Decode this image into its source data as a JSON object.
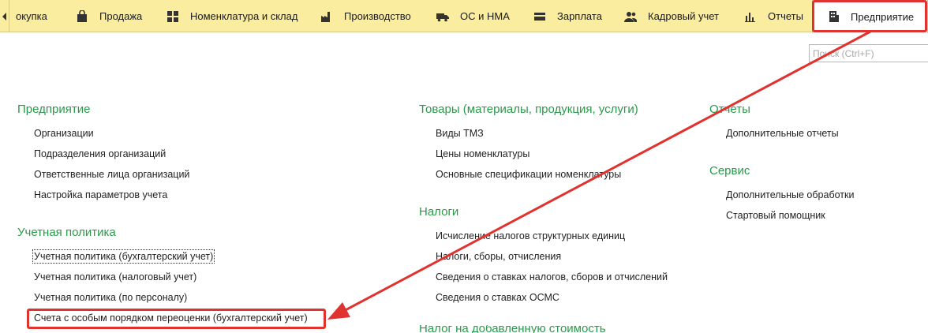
{
  "sections_bar": {
    "tabs": [
      {
        "label": "окупка",
        "icon": "purchase-icon"
      },
      {
        "label": "Продажа",
        "icon": "bag-icon"
      },
      {
        "label": "Номенклатура и склад",
        "icon": "grid-icon"
      },
      {
        "label": "Производство",
        "icon": "factory-icon"
      },
      {
        "label": "ОС и НМА",
        "icon": "truck-icon"
      },
      {
        "label": "Зарплата",
        "icon": "wallet-icon"
      },
      {
        "label": "Кадровый учет",
        "icon": "people-icon"
      },
      {
        "label": "Отчеты",
        "icon": "bar-chart-icon"
      },
      {
        "label": "Предприятие",
        "icon": "building-icon"
      }
    ],
    "active_tab": "Предприятие"
  },
  "search": {
    "placeholder": "Поиск (Ctrl+F)",
    "value": ""
  },
  "columns": [
    {
      "groups": [
        {
          "title": "Предприятие",
          "items": [
            "Организации",
            "Подразделения организаций",
            "Ответственные лица организаций",
            "Настройка параметров учета"
          ]
        },
        {
          "title": "Учетная политика",
          "items": [
            "Учетная политика (бухгалтерский учет)",
            "Учетная политика (налоговый учет)",
            "Учетная политика (по персоналу)",
            "Счета с особым порядком переоценки (бухгалтерский учет)"
          ]
        }
      ]
    },
    {
      "groups": [
        {
          "title": "Товары (материалы, продукция, услуги)",
          "items": [
            "Виды ТМЗ",
            "Цены номенклатуры",
            "Основные спецификации номенклатуры"
          ]
        },
        {
          "title": "Налоги",
          "items": [
            "Исчисление налогов структурных единиц",
            "Налоги, сборы, отчисления",
            "Сведения о ставках налогов, сборов и отчислений",
            "Сведения о ставках ОСМС"
          ]
        },
        {
          "title": "Налог на добавленную стоимость",
          "items": []
        }
      ]
    },
    {
      "groups": [
        {
          "title": "Отчеты",
          "items": [
            "Дополнительные отчеты"
          ]
        },
        {
          "title": "Сервис",
          "items": [
            "Дополнительные обработки",
            "Стартовый помощник"
          ]
        }
      ]
    }
  ],
  "colors": {
    "bar": "#fbeda0",
    "group_title": "#2a9a4a",
    "annotation": "#e0322e"
  }
}
